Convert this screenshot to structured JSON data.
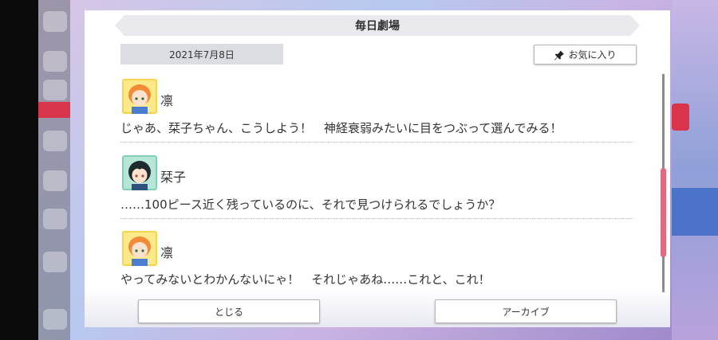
{
  "dialog": {
    "title": "毎日劇場",
    "date": "2021年7月8日",
    "favorite_label": "お気に入り",
    "close_label": "とじる",
    "archive_label": "アーカイブ"
  },
  "entries": [
    {
      "speaker": "凛",
      "text": "じゃあ、栞子ちゃん、こうしよう！　神経衰弱みたいに目をつぶって選んでみる！"
    },
    {
      "speaker": "栞子",
      "text": "……100ピース近く残っているのに、それで見つけられるでしょうか？"
    },
    {
      "speaker": "凛",
      "text": "やってみないとわかんないにゃ！　それじゃあね……これと、これ！"
    }
  ],
  "colors": {
    "rin_avatar_bg": "#f6d34a",
    "rin_hair": "#f28a36",
    "shioriko_avatar_bg": "#7fd1b9",
    "shioriko_hair": "#1f2a2f",
    "scroll_thumb": "#e26a80",
    "title_bar": "#e9e9ee",
    "date_badge": "#dcdde3"
  },
  "icons": {
    "favorite": "pin-icon"
  }
}
